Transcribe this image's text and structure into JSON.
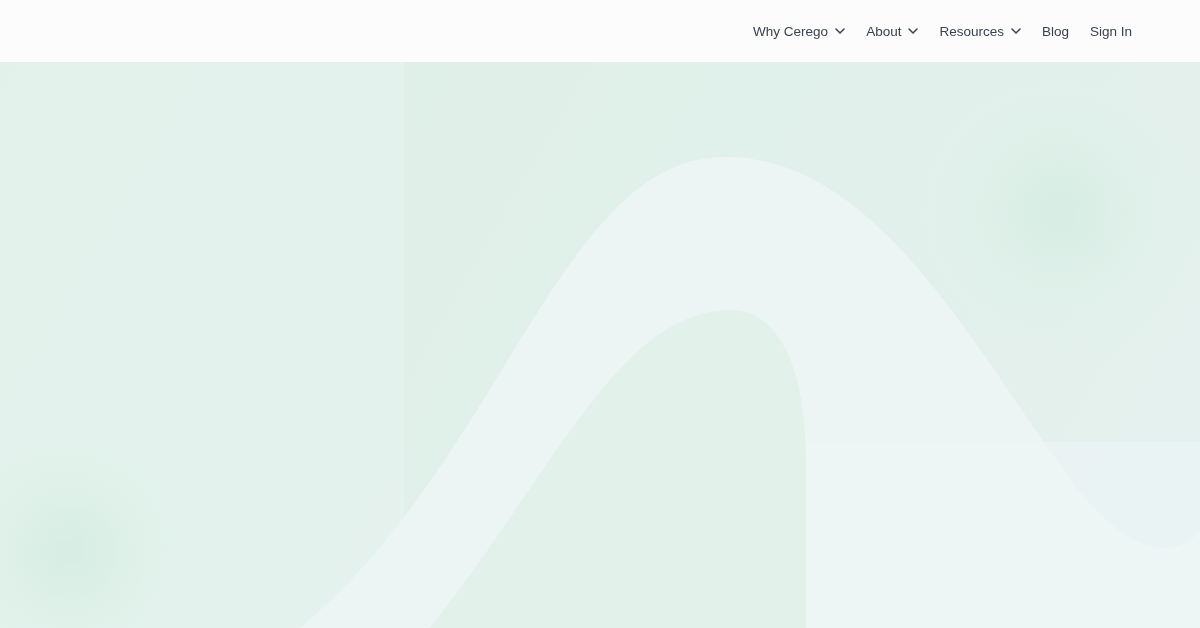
{
  "nav": {
    "items": [
      {
        "label": "Why Cerego",
        "kind": "dropdown"
      },
      {
        "label": "About",
        "kind": "dropdown"
      },
      {
        "label": "Resources",
        "kind": "dropdown"
      },
      {
        "label": "Blog",
        "kind": "link"
      },
      {
        "label": "Sign In",
        "kind": "link"
      }
    ]
  }
}
